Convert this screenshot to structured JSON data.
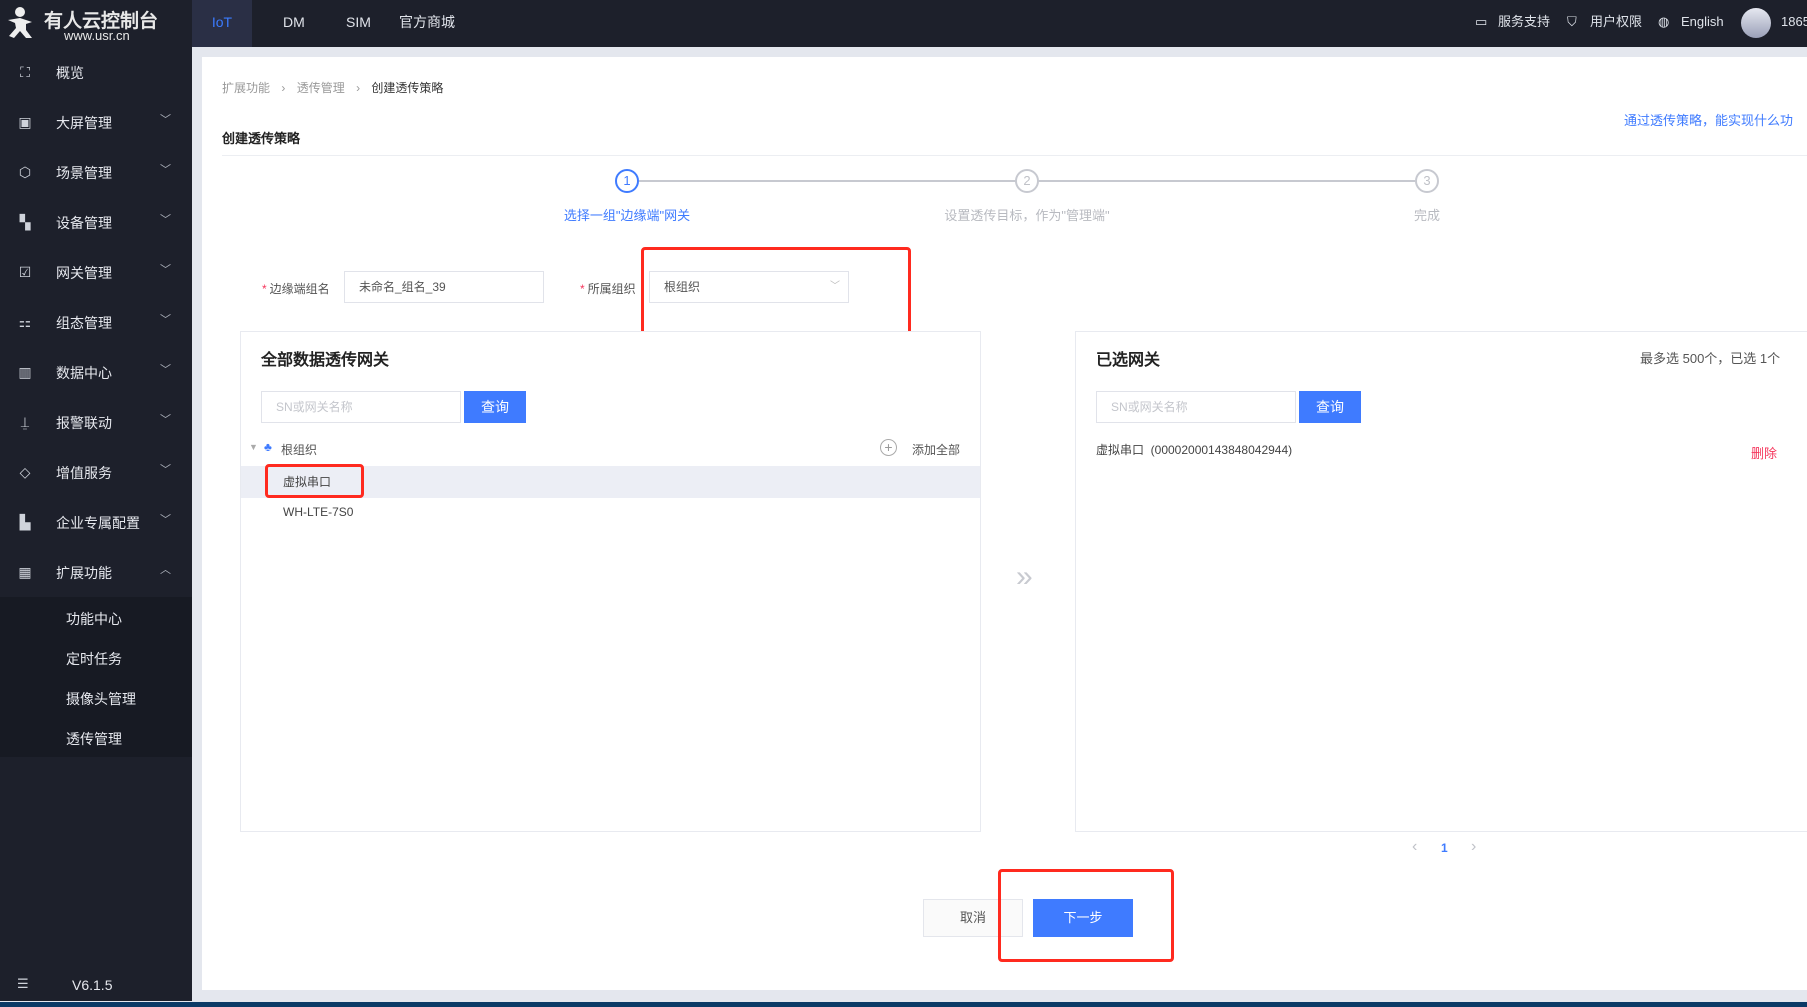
{
  "brand": {
    "name": "有人云控制台",
    "url": "www.usr.cn"
  },
  "top_tabs": [
    {
      "label": "IoT",
      "active": true
    },
    {
      "label": "DM"
    },
    {
      "label": "SIM"
    },
    {
      "label": "官方商城"
    }
  ],
  "top_right": {
    "support": "服务支持",
    "permissions": "用户权限",
    "language": "English",
    "user": "1865"
  },
  "sidebar": {
    "items": [
      {
        "label": "概览",
        "icon": "overview-icon"
      },
      {
        "label": "大屏管理",
        "icon": "screen-icon"
      },
      {
        "label": "场景管理",
        "icon": "scene-icon"
      },
      {
        "label": "设备管理",
        "icon": "device-icon"
      },
      {
        "label": "网关管理",
        "icon": "gateway-icon"
      },
      {
        "label": "组态管理",
        "icon": "config-icon"
      },
      {
        "label": "数据中心",
        "icon": "data-icon"
      },
      {
        "label": "报警联动",
        "icon": "alarm-icon"
      },
      {
        "label": "增值服务",
        "icon": "diamond-icon"
      },
      {
        "label": "企业专属配置",
        "icon": "building-icon"
      },
      {
        "label": "扩展功能",
        "icon": "grid-icon",
        "expanded": true
      }
    ],
    "sub_items": [
      "功能中心",
      "定时任务",
      "摄像头管理",
      "透传管理"
    ],
    "version": "V6.1.5"
  },
  "breadcrumb": [
    "扩展功能",
    "透传管理",
    "创建透传策略"
  ],
  "page_title": "创建透传策略",
  "help_link": "通过透传策略，能实现什么功",
  "steps": [
    {
      "num": "1",
      "label": "选择一组\"边缘端\"网关",
      "active": true
    },
    {
      "num": "2",
      "label": "设置透传目标，作为\"管理端\""
    },
    {
      "num": "3",
      "label": "完成"
    }
  ],
  "form": {
    "group_label": "边缘端组名",
    "group_value": "未命名_组名_39",
    "org_label": "所属组织",
    "org_value": "根组织"
  },
  "left_panel": {
    "title": "全部数据透传网关",
    "search_placeholder": "SN或网关名称",
    "search_btn": "查询",
    "root": "根组织",
    "add_all": "添加全部",
    "items": [
      "虚拟串口",
      "WH-LTE-7S0"
    ]
  },
  "right_panel": {
    "title": "已选网关",
    "limit_text": "最多选 500个，已选 1个",
    "search_placeholder": "SN或网关名称",
    "search_btn": "查询",
    "items": [
      {
        "name": "虚拟串口  (00002000143848042944)",
        "action": "删除"
      }
    ]
  },
  "pagination": {
    "prev": "‹",
    "page": "1",
    "next": "›"
  },
  "buttons": {
    "cancel": "取消",
    "next": "下一步"
  },
  "colors": {
    "accent": "#3f7bff",
    "danger": "#f5365c",
    "highlight": "#ff2a1f"
  }
}
